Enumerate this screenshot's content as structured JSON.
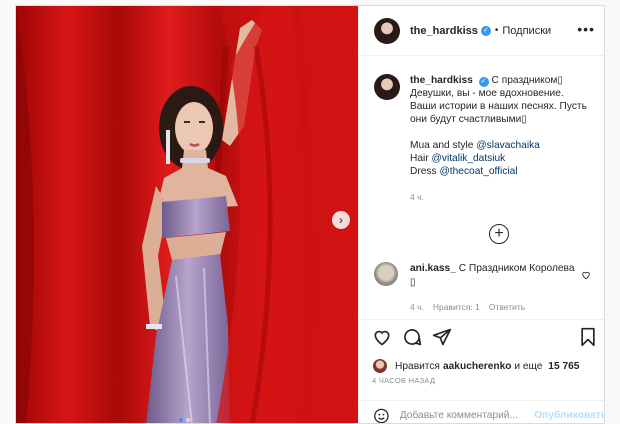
{
  "post": {
    "username": "the_hardkiss",
    "verified_mark": "✓",
    "bullet": "•",
    "follow_label": "Подписки",
    "menu_label": "•••",
    "caption": {
      "username": "the_hardkiss",
      "line1": "С праздником",
      "line2": "Девушки, вы - мое вдохновение.",
      "line3": "Ваши истории в наших песнях. Пусть",
      "line4": "они будут счастливыми",
      "mua_prefix": "Mua and style ",
      "mua_link": "@slavachaika",
      "hair_prefix": "Hair ",
      "hair_link": "@vitalik_datsiuk",
      "dress_prefix": "Dress ",
      "dress_link": "@thecoat_official",
      "time": "4 ч."
    },
    "more_comments": "+",
    "comment": {
      "username": "ani.kass_",
      "text": "С Праздником Королева",
      "time": "4 ч.",
      "likes": "Нравится: 1",
      "reply": "Ответить"
    },
    "likes": {
      "prefix": "Нравится ",
      "liker": "aakucherenko",
      "middle": " и еще ",
      "count": "15 765"
    },
    "timestamp": "4 ЧАСОВ НАЗАД",
    "add_comment_placeholder": "Добавьте комментарий...",
    "publish_label": "Опубликовать",
    "next_arrow": "›"
  },
  "icons": {
    "heart": "heart-icon",
    "comment": "comment-icon",
    "share": "share-icon",
    "bookmark": "bookmark-icon",
    "emoji": "smile-icon"
  },
  "carousel": {
    "total": 2,
    "active": 1
  },
  "colors": {
    "accent": "#3897f0",
    "curtain": "#c40d0d",
    "link": "#00376b"
  }
}
